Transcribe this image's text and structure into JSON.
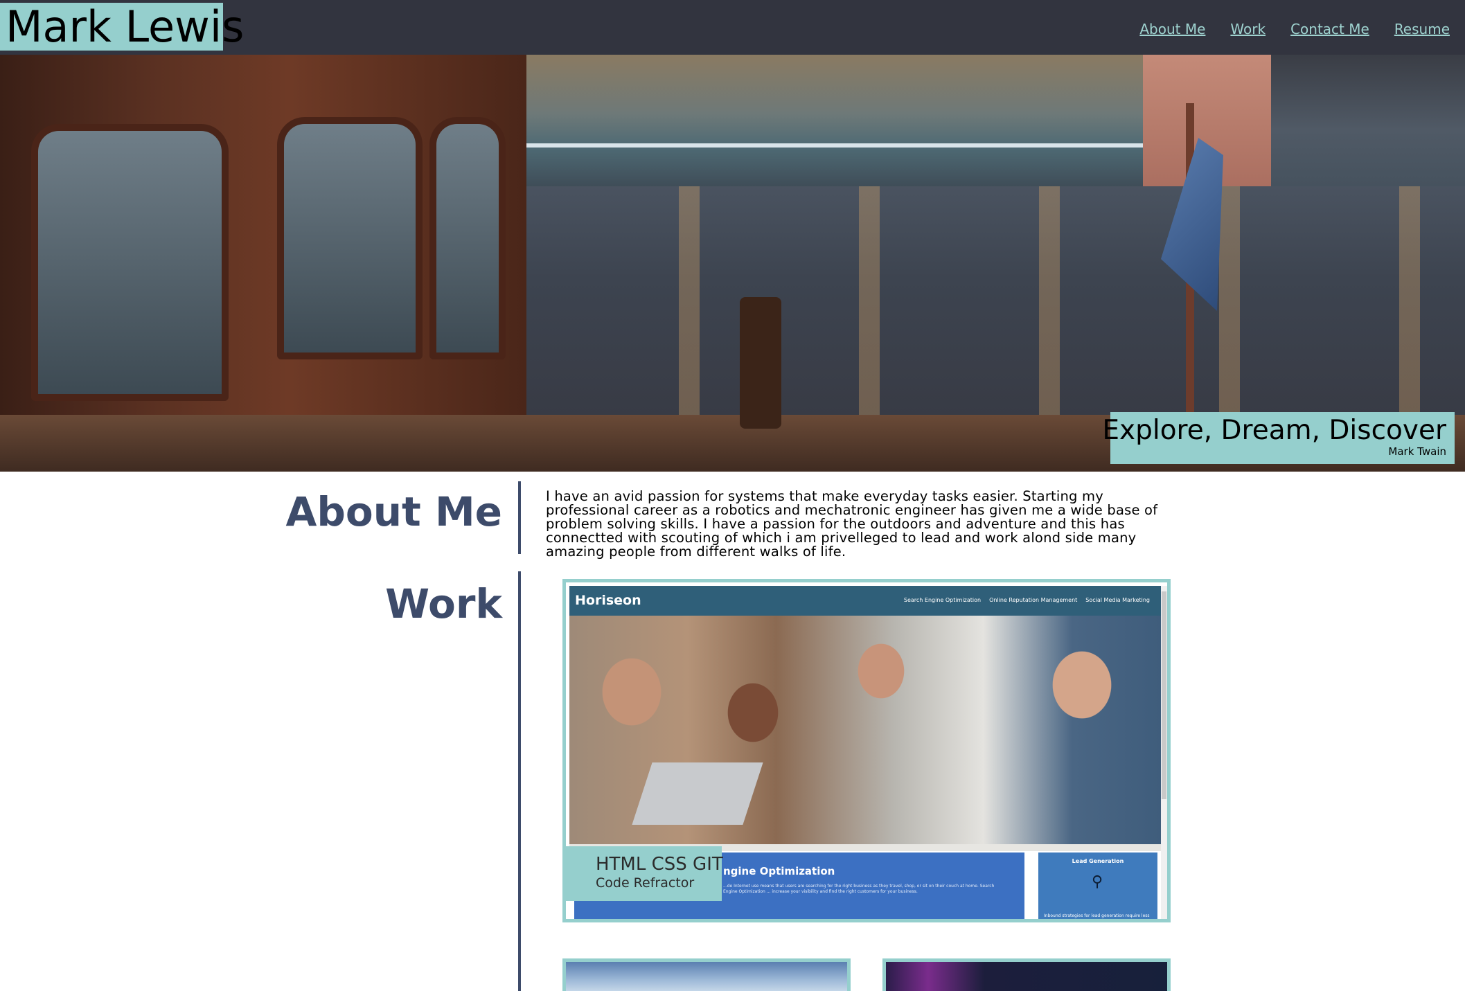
{
  "header": {
    "name": "Mark Lewis",
    "nav": [
      "About Me",
      "Work",
      "Contact Me",
      "Resume"
    ]
  },
  "hero": {
    "quote": "Explore, Dream, Discover",
    "author": "Mark Twain"
  },
  "about": {
    "title": "About Me",
    "text": "I have an avid passion for systems that make everyday tasks easier. Starting my professional career as a robotics and mechatronic engineer has given me a wide base of problem solving skills. I have a passion for the outdoors and adventure and this has connectted with scouting of which i am privelleged to lead and work alond side many amazing people from different walks of life."
  },
  "work": {
    "title": "Work",
    "featured": {
      "caption_title": "HTML CSS GIT",
      "caption_subtitle": "Code Refractor",
      "screenshot": {
        "logo": "Horiseon",
        "links": [
          "Search Engine Optimization",
          "Online Reputation Management",
          "Social Media Marketing"
        ],
        "section_title": "ngine Optimization",
        "section_text": "...de Internet use means that users are searching for the right business as they travel, shop, or sit on their couch at home. Search Engine Optimization ... increase your visibility and find the right customers for your business.",
        "side_title": "Lead Generation",
        "side_icon": "lightbulb-icon",
        "side_text": "Inbound strategies for lead generation require less work for your business, bringing customers directly to your website."
      }
    }
  },
  "colors": {
    "header_bg": "#32343f",
    "accent": "#95cfcd",
    "heading": "#3d4b6a",
    "nav_link": "#9fd3d0"
  }
}
